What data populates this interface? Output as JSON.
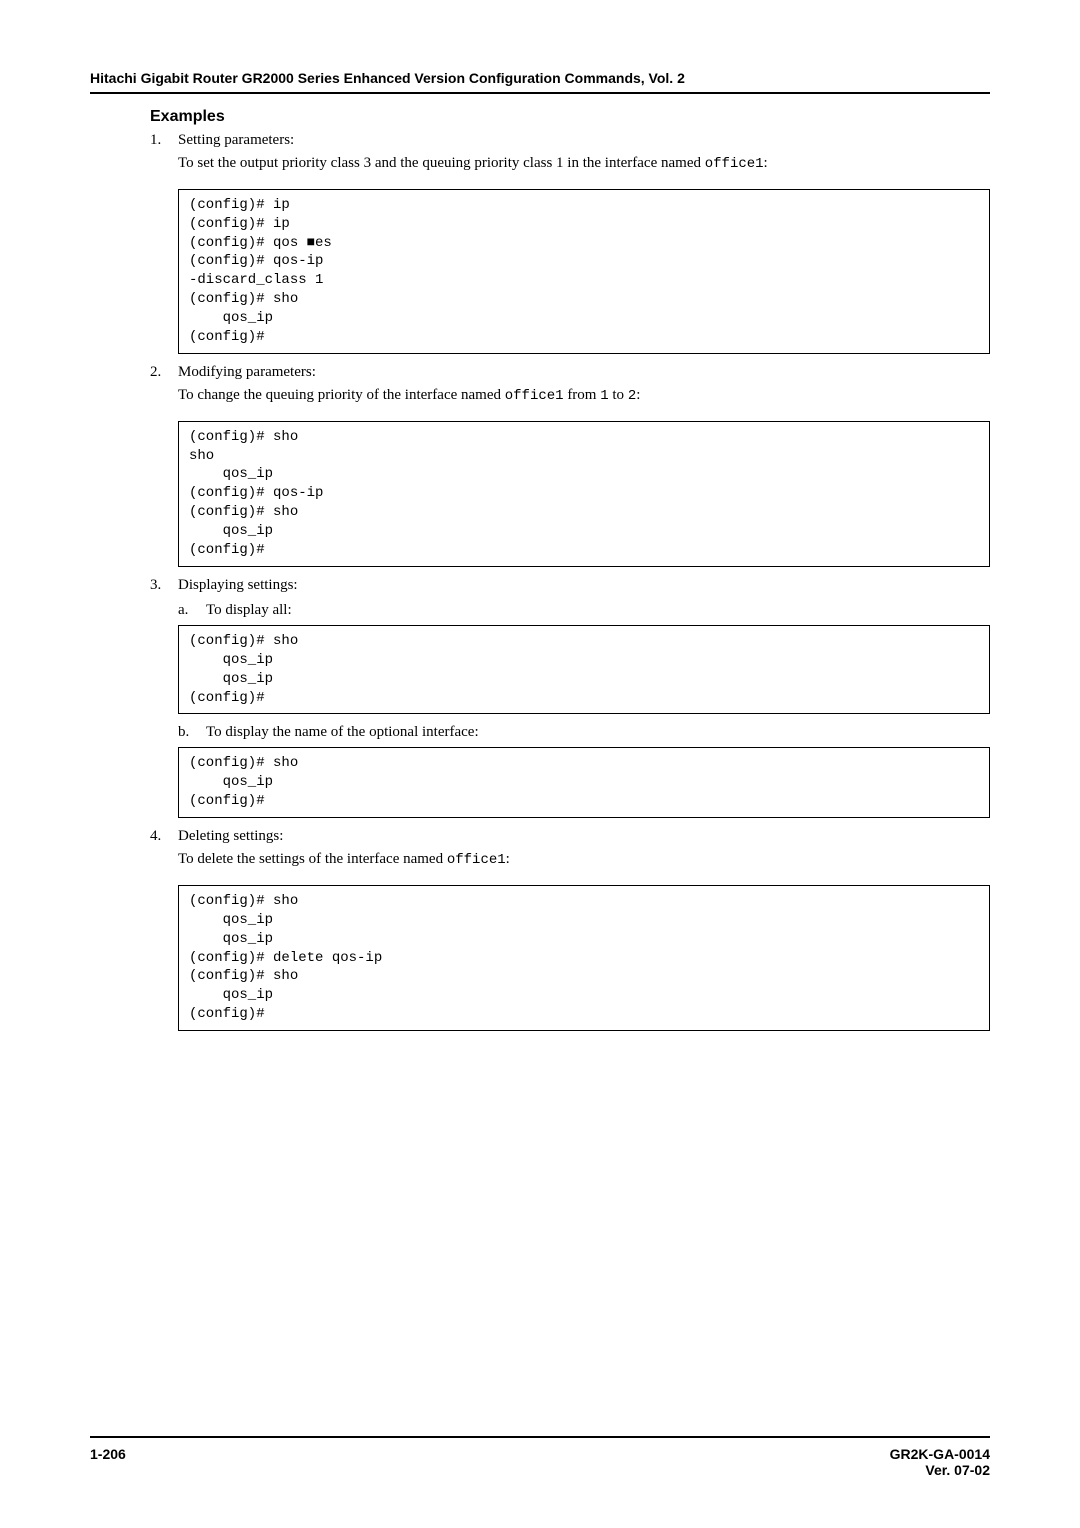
{
  "header": {
    "title": "Hitachi Gigabit Router GR2000 Series Enhanced Version Configuration Commands, Vol. 2"
  },
  "section": {
    "heading": "Examples"
  },
  "items": [
    {
      "num": "1.",
      "title": "Setting parameters:",
      "desc_parts": [
        "To set the output priority class 3 and the queuing priority class 1 in the interface named ",
        "office1",
        ":"
      ],
      "code": "(config)# ip\n(config)# ip\n(config)# qos ■es\n(config)# qos-ip\n-discard_class 1\n(config)# sho\n    qos_ip\n(config)#"
    },
    {
      "num": "2.",
      "title": "Modifying parameters:",
      "desc_parts": [
        "To change the queuing priority of the interface named ",
        "office1",
        " from ",
        "1",
        " to ",
        "2",
        ":"
      ],
      "code": "(config)# sho\nsho\n    qos_ip\n(config)# qos-ip\n(config)# sho\n    qos_ip\n(config)#"
    },
    {
      "num": "3.",
      "title": "Displaying settings:",
      "subs": [
        {
          "letter": "a.",
          "text": "To display all:",
          "code": "(config)# sho\n    qos_ip\n    qos_ip\n(config)#"
        },
        {
          "letter": "b.",
          "text": "To display the name of the optional interface:",
          "code": "(config)# sho\n    qos_ip\n(config)#"
        }
      ]
    },
    {
      "num": "4.",
      "title": "Deleting settings:",
      "desc_parts": [
        "To delete the settings of the interface named ",
        "office1",
        ":"
      ],
      "code": "(config)# sho\n    qos_ip\n    qos_ip\n(config)# delete qos-ip\n(config)# sho\n    qos_ip\n(config)#"
    }
  ],
  "footer": {
    "left": "1-206",
    "right1": "GR2K-GA-0014",
    "right2": "Ver. 07-02"
  }
}
